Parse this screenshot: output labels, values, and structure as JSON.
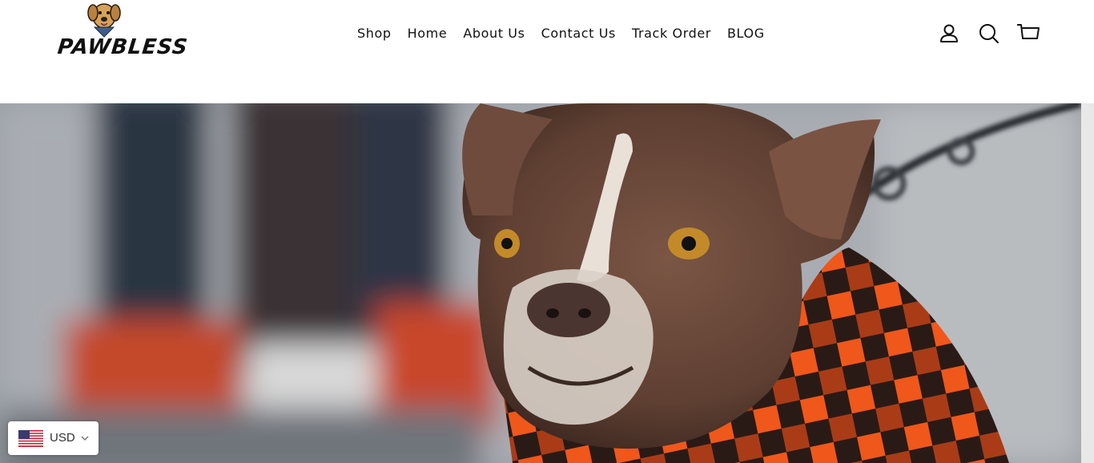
{
  "brand": {
    "logo_text": "PAWBLESS"
  },
  "nav": {
    "items": [
      {
        "label": "Shop"
      },
      {
        "label": "Home"
      },
      {
        "label": "About Us"
      },
      {
        "label": "Contact Us"
      },
      {
        "label": "Track Order"
      },
      {
        "label": "BLOG"
      }
    ]
  },
  "header_icons": [
    "account-icon",
    "search-icon",
    "cart-icon"
  ],
  "hero": {
    "image_subject": "brown dog in orange plaid bandana on leash"
  },
  "currency": {
    "code": "USD",
    "flag": "us-flag-icon"
  },
  "colors": {
    "text": "#111111",
    "plaid_orange": "#f0571b",
    "dog_brown": "#6b4a3a"
  }
}
